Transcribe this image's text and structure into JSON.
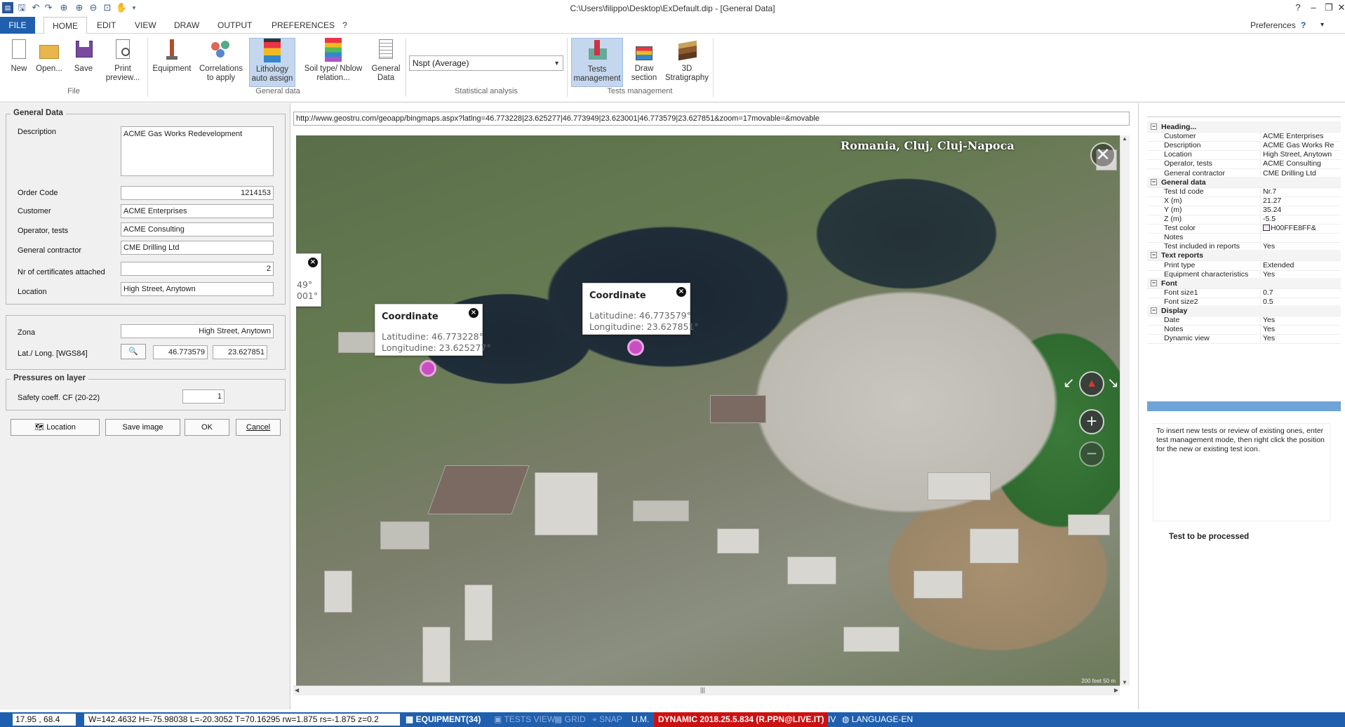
{
  "window": {
    "title": "C:\\Users\\filippo\\Desktop\\ExDefault.dip - [General Data]",
    "preferences_label": "Preferences"
  },
  "tabs": [
    "FILE",
    "HOME",
    "EDIT",
    "VIEW",
    "DRAW",
    "OUTPUT",
    "PREFERENCES",
    "?"
  ],
  "ribbon": {
    "new": "New",
    "open": "Open...",
    "save": "Save",
    "print": "Print preview...",
    "equipment": "Equipment",
    "correlations": "Correlations to apply",
    "lithology": "Lithology auto assign",
    "soil_type": "Soil type/ Nblow relation...",
    "general_data": "General Data",
    "tests_management": "Tests management",
    "draw_section": "Draw section",
    "stratigraphy": "3D Stratigraphy",
    "groups": {
      "file": "File",
      "general": "General data",
      "stat": "Statistical analysis",
      "tests": "Tests management"
    },
    "nspt_select": "Nspt (Average)"
  },
  "general": {
    "legend": "General Data",
    "description_label": "Description",
    "description": "ACME Gas Works  Redevelopment",
    "order_label": "Order Code",
    "order": "1214153",
    "customer_label": "Customer",
    "customer": "ACME Enterprises",
    "operator_label": "Operator, tests",
    "operator": "ACME Consulting",
    "contractor_label": "General contractor",
    "contractor": "CME Drilling Ltd",
    "certs_label": "Nr of certificates attached",
    "certs": "2",
    "location_label": "Location",
    "location": "High Street, Anytown"
  },
  "zona": {
    "zona_label": "Zona",
    "zona": "High Street, Anytown",
    "latlong_label": "Lat./ Long. [WGS84]",
    "lat": "46.773579",
    "long": "23.627851"
  },
  "pressures": {
    "legend": "Pressures on layer",
    "safety_label": "Safety coeff. CF (20-22)",
    "safety": "1"
  },
  "buttons": {
    "location": "Location",
    "save_image": "Save image",
    "ok": "OK",
    "cancel": "Cancel"
  },
  "map": {
    "url": "http://www.geostru.com/geoapp/bingmaps.aspx?latlng=46.773228|23.625277|46.773949|23.623001|46.773579|23.627851&zoom=17movable=&movable",
    "place_label": "Romania, Cluj, Cluj-Napoca",
    "popups": [
      {
        "title": "Coordinate",
        "lat": "Latitudine: 46.773228°",
        "long": "Longitudine: 23.625277°"
      },
      {
        "title": "Coordinate",
        "lat": "Latitudine: 46.773579°",
        "long": "Longitudine: 23.627851°"
      },
      {
        "lat": "49°",
        "long": "001°"
      }
    ],
    "scale": "200 feet      50 m"
  },
  "properties": [
    {
      "type": "header",
      "k": "Heading..."
    },
    {
      "k": "Customer",
      "v": "ACME Enterprises"
    },
    {
      "k": "Description",
      "v": "ACME Gas Works  Re"
    },
    {
      "k": "Location",
      "v": "High Street, Anytown"
    },
    {
      "k": "Operator, tests",
      "v": "ACME Consulting"
    },
    {
      "k": "General contractor",
      "v": "CME Drilling Ltd"
    },
    {
      "type": "header",
      "k": "General data"
    },
    {
      "k": "Test Id code",
      "v": " Nr.7"
    },
    {
      "k": "X (m)",
      "v": "21.27"
    },
    {
      "k": "Y (m)",
      "v": "35.24"
    },
    {
      "k": "Z (m)",
      "v": "-5.5"
    },
    {
      "k": "Test color",
      "v": "H00FFE8FF&"
    },
    {
      "k": "Notes",
      "v": ""
    },
    {
      "k": "Test included in reports",
      "v": "Yes"
    },
    {
      "type": "header",
      "k": "Text reports"
    },
    {
      "k": "Print type",
      "v": "Extended"
    },
    {
      "k": "Equipment characteristics",
      "v": "Yes"
    },
    {
      "type": "header",
      "k": "Font"
    },
    {
      "k": "Font size1",
      "v": "0.7"
    },
    {
      "k": "Font size2",
      "v": "0.5"
    },
    {
      "type": "header",
      "k": "Display"
    },
    {
      "k": "Date",
      "v": "Yes"
    },
    {
      "k": "Notes",
      "v": "Yes"
    },
    {
      "k": "Dynamic view",
      "v": "Yes"
    }
  ],
  "help_text": "To insert new tests or review of existing ones, enter test management mode, then right click the position for the new or existing test icon.",
  "test_status": "Test to be processed",
  "status": {
    "coords": "17.95 , 68.4",
    "dims": "W=142.4632 H=-75.98038 L=-20.3052 T=70.16295 rw=1.875 rs=-1.875 z=0.2",
    "equipment": "EQUIPMENT(34)",
    "tests_view": "TESTS VIEW",
    "grid": "GRID",
    "snap": "SNAP",
    "um": "U.M.",
    "dynamic": "DYNAMIC 2018.25.5.834 (R.PPN@LIVE.IT)",
    "iv": "IV",
    "language": "LANGUAGE-EN"
  },
  "colors": {
    "accent": "#1f5fae",
    "status_red": "#cc1111",
    "pin": "#c94fc0"
  }
}
